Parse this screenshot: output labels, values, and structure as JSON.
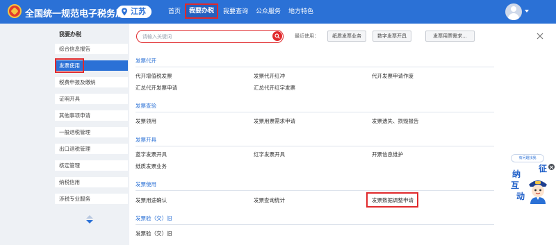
{
  "header": {
    "site_title": "全国统一规范电子税务局",
    "region": "江苏",
    "nav": [
      "首页",
      "我要办税",
      "我要查询",
      "公众服务",
      "地方特色"
    ],
    "colors": {
      "brand": "#2b71d6",
      "highlight": "#e0292c"
    }
  },
  "sidebar": {
    "title": "我要办税",
    "items": [
      "综合信息报告",
      "发票使用",
      "税费申报及缴纳",
      "证明开具",
      "其他事项申请",
      "一般退税管理",
      "出口退税管理",
      "核定管理",
      "纳税信用",
      "涉税专业服务"
    ]
  },
  "search": {
    "placeholder": "请输入关键词"
  },
  "recent": {
    "label": "最近使用：",
    "items": [
      "纸质发票业务",
      "数字发票开具",
      "发票用票需求..."
    ]
  },
  "sections": [
    {
      "title": "发票代开",
      "links": [
        "代开增值税发票",
        "发票代开红冲",
        "代开发票申请作废",
        "汇总代开发票申请",
        "汇总代开红字发票"
      ]
    },
    {
      "title": "发票查验",
      "links": [
        "发票领用",
        "发票用票需求申请",
        "发票遗失、损毁报告"
      ]
    },
    {
      "title": "发票开具",
      "links": [
        "蓝字发票开具",
        "红字发票开具",
        "开票信息维护",
        "纸质发票业务"
      ]
    },
    {
      "title": "发票使用",
      "links": [
        "发票用途确认",
        "发票查询统计",
        "发票数据调整申请"
      ]
    },
    {
      "title": "发票验（交）旧",
      "links": [
        "发票验（交）旧"
      ]
    }
  ],
  "mascot": {
    "bubble": "有问题找我",
    "characters": [
      "征",
      "纳",
      "互",
      "动"
    ]
  },
  "icons": {
    "search": "search-icon",
    "close": "close-icon",
    "avatar": "user-avatar-icon",
    "pin": "location-pin-icon"
  }
}
